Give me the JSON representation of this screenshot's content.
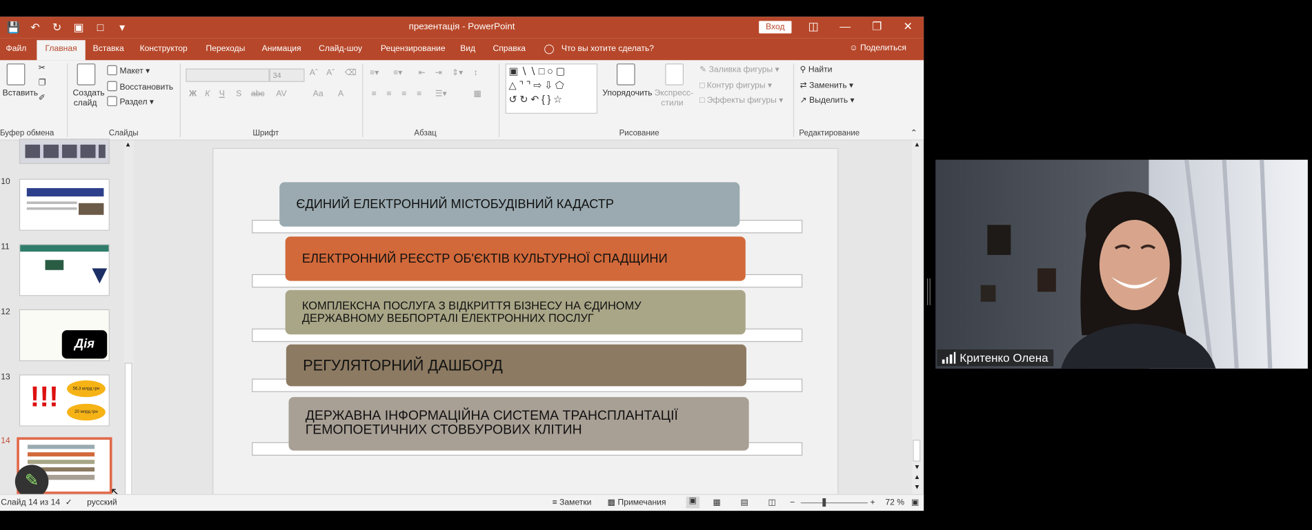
{
  "app": {
    "title": "презентація  -  PowerPoint",
    "login_button": "Вход",
    "accent_color": "#b7472a",
    "window_controls": [
      "ribbon-display-icon",
      "minimize-icon",
      "restore-icon",
      "close-icon"
    ]
  },
  "quick_access": [
    "save-icon",
    "undo-icon",
    "redo-icon",
    "start-from-beginning-icon",
    "new-icon",
    "customize-qat-icon"
  ],
  "tabs": [
    {
      "label": "Файл"
    },
    {
      "label": "Главная"
    },
    {
      "label": "Вставка"
    },
    {
      "label": "Конструктор"
    },
    {
      "label": "Переходы"
    },
    {
      "label": "Анимация"
    },
    {
      "label": "Слайд-шоу"
    },
    {
      "label": "Рецензирование"
    },
    {
      "label": "Вид"
    },
    {
      "label": "Справка"
    }
  ],
  "active_tab": "Главная",
  "tell_me": "Что вы хотите сделать?",
  "share": "Поделиться",
  "ribbon": {
    "clipboard": {
      "label": "Буфер обмена",
      "paste": "Вставить"
    },
    "slides": {
      "label": "Слайды",
      "new_slide_line1": "Создать",
      "new_slide_line2": "слайд",
      "layout": "Макет",
      "reset": "Восстановить",
      "section": "Раздел"
    },
    "font": {
      "label": "Шрифт",
      "size": "34",
      "bold": "Ж",
      "italic": "К",
      "underline": "Ч",
      "strike": "S",
      "spacing": "AV",
      "aa": "Аа",
      "color_a": "А"
    },
    "paragraph": {
      "label": "Абзац"
    },
    "drawing": {
      "label": "Рисование",
      "arrange": "Упорядочить",
      "quick_styles_line1": "Экспресс-",
      "quick_styles_line2": "стили",
      "shape_fill": "Заливка фигуры",
      "shape_outline": "Контур фигуры",
      "shape_effects": "Эффекты фигуры"
    },
    "editing": {
      "label": "Редактирование",
      "find": "Найти",
      "replace": "Заменить",
      "select": "Выделить"
    }
  },
  "thumbnails": [
    {
      "num": ""
    },
    {
      "num": "10"
    },
    {
      "num": "11"
    },
    {
      "num": "12",
      "text": "Дія"
    },
    {
      "num": "13",
      "oval1": "56,3 млрд грн",
      "oval2": "20 млрд грн"
    },
    {
      "num": "14"
    }
  ],
  "slide": {
    "items": [
      {
        "text": "ЄДИНИЙ ЕЛЕКТРОННИЙ МІСТОБУДІВНИЙ КАДАСТР",
        "color": "#9aaab0"
      },
      {
        "text": "ЕЛЕКТРОННИЙ РЕЄСТР ОБ'ЄКТІВ КУЛЬТУРНОЇ СПАДЩИНИ",
        "color": "#d2693a"
      },
      {
        "text": "КОМПЛЕКСНА ПОСЛУГА З ВІДКРИТТЯ БІЗНЕСУ НА ЄДИНОМУ ДЕРЖАВНОМУ ВЕБПОРТАЛІ ЕЛЕКТРОННИХ ПОСЛУГ",
        "color": "#a9a687"
      },
      {
        "text": "РЕГУЛЯТОРНИЙ ДАШБОРД",
        "color": "#8c7a62"
      },
      {
        "text": "ДЕРЖАВНА ІНФОРМАЦІЙНА СИСТЕМА ТРАНСПЛАНТАЦІЇ ГЕМОПОЕТИЧНИХ СТОВБУРОВИХ КЛІТИН",
        "color": "#a89f95"
      }
    ]
  },
  "status": {
    "slide_counter": "Слайд 14 из 14",
    "language": "русский",
    "notes": "Заметки",
    "comments": "Примечания",
    "zoom_level": "72 %",
    "zoom_fraction": 0.72
  },
  "video": {
    "participant_name": "Критенко Олена"
  }
}
